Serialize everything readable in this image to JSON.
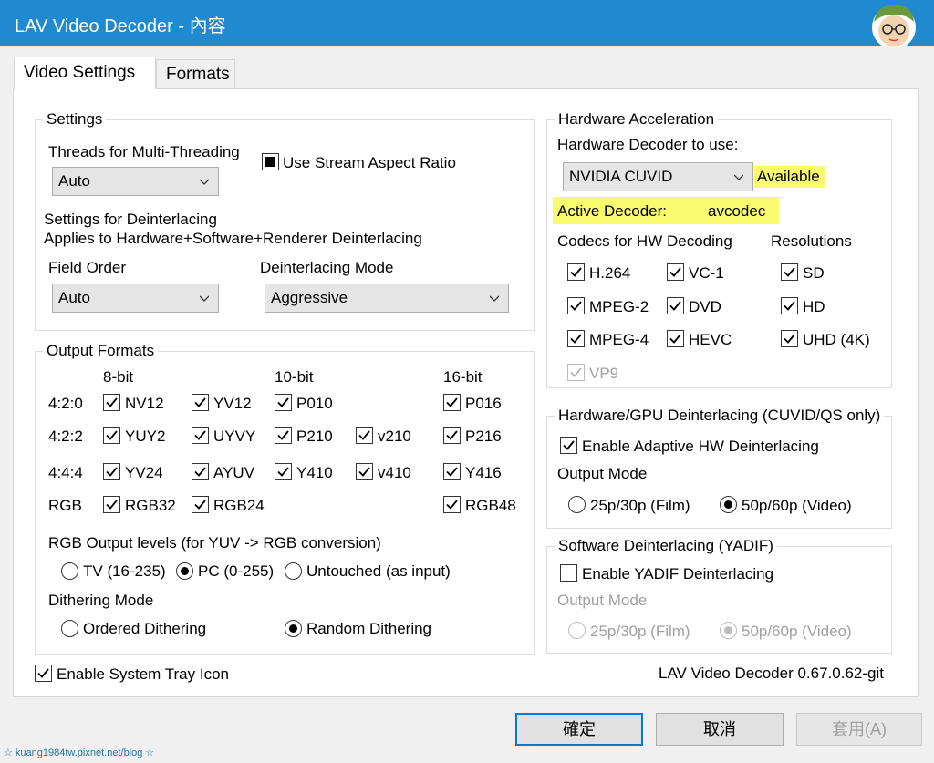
{
  "window": {
    "title": "LAV Video Decoder - 內容"
  },
  "tabs": [
    {
      "label": "Video Settings"
    },
    {
      "label": "Formats"
    }
  ],
  "settings": {
    "group_label": "Settings",
    "threads_label": "Threads for Multi-Threading",
    "threads_value": "Auto",
    "stream_aspect_label": "Use Stream Aspect Ratio",
    "deint_title": "Settings for Deinterlacing",
    "deint_applies": "Applies to Hardware+Software+Renderer Deinterlacing",
    "field_order_label": "Field Order",
    "field_order_value": "Auto",
    "deint_mode_label": "Deinterlacing Mode",
    "deint_mode_value": "Aggressive"
  },
  "output": {
    "group_label": "Output Formats",
    "h8": "8-bit",
    "h10": "10-bit",
    "h16": "16-bit",
    "rows": [
      "4:2:0",
      "4:2:2",
      "4:4:4",
      "RGB"
    ],
    "f": {
      "nv12": "NV12",
      "yv12": "YV12",
      "p010": "P010",
      "p016": "P016",
      "yuy2": "YUY2",
      "uyvy": "UYVY",
      "p210": "P210",
      "v210": "v210",
      "p216": "P216",
      "yv24": "YV24",
      "ayuv": "AYUV",
      "y410": "Y410",
      "v410": "v410",
      "y416": "Y416",
      "rgb32": "RGB32",
      "rgb24": "RGB24",
      "rgb48": "RGB48"
    },
    "levels_label": "RGB Output levels (for YUV -> RGB conversion)",
    "levels": [
      "TV (16-235)",
      "PC (0-255)",
      "Untouched (as input)"
    ],
    "dither_label": "Dithering Mode",
    "dither": [
      "Ordered Dithering",
      "Random Dithering"
    ]
  },
  "tray": {
    "label": "Enable System Tray Icon"
  },
  "hw": {
    "group_label": "Hardware Acceleration",
    "decoder_label": "Hardware Decoder to use:",
    "decoder_value": "NVIDIA CUVID",
    "available": "Available",
    "active_label": "Active Decoder:",
    "active_value": "avcodec",
    "codecs_label": "Codecs for HW Decoding",
    "res_label": "Resolutions",
    "codecs": {
      "h264": "H.264",
      "vc1": "VC-1",
      "mpeg2": "MPEG-2",
      "dvd": "DVD",
      "mpeg4": "MPEG-4",
      "hevc": "HEVC",
      "vp9": "VP9"
    },
    "res": {
      "sd": "SD",
      "hd": "HD",
      "uhd": "UHD (4K)"
    }
  },
  "gpu_deint": {
    "group_label": "Hardware/GPU Deinterlacing (CUVID/QS only)",
    "enable_label": "Enable Adaptive HW Deinterlacing",
    "mode_label": "Output Mode",
    "opt_film": "25p/30p (Film)",
    "opt_video": "50p/60p (Video)"
  },
  "sw_deint": {
    "group_label": "Software Deinterlacing (YADIF)",
    "enable_label": "Enable YADIF Deinterlacing",
    "mode_label": "Output Mode",
    "opt_film": "25p/30p (Film)",
    "opt_video": "50p/60p (Video)"
  },
  "version": "LAV Video Decoder 0.67.0.62-git",
  "buttons": {
    "ok": "確定",
    "cancel": "取消",
    "apply": "套用(A)"
  },
  "watermark": "☆ kuang1984tw.pixnet.net/blog ☆",
  "colors": {
    "titlebar": "#1f8ad0",
    "highlight": "#fafa6e",
    "default_button_border": "#0078d7"
  }
}
